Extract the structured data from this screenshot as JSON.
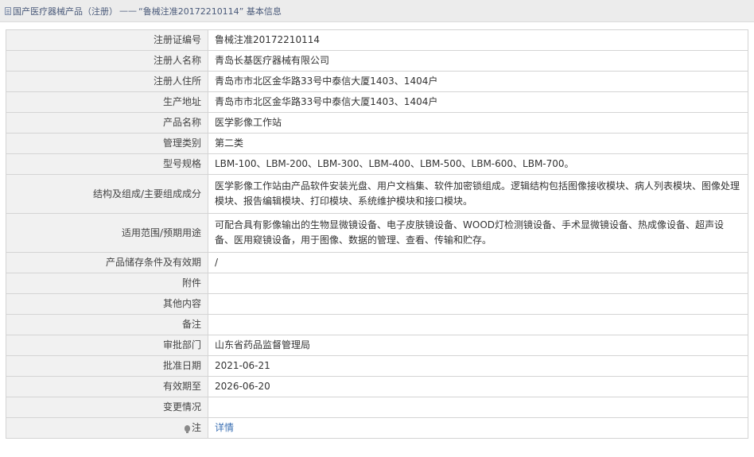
{
  "breadcrumb": {
    "root": "国产医疗器械产品（注册）",
    "separator": "——",
    "current": "“鲁械注准20172210114” 基本信息"
  },
  "rows": [
    {
      "label": "注册证编号",
      "value": "鲁械注准20172210114"
    },
    {
      "label": "注册人名称",
      "value": "青岛长基医疗器械有限公司"
    },
    {
      "label": "注册人住所",
      "value": "青岛市市北区金华路33号中泰信大厦1403、1404户"
    },
    {
      "label": "生产地址",
      "value": "青岛市市北区金华路33号中泰信大厦1403、1404户"
    },
    {
      "label": "产品名称",
      "value": "医学影像工作站"
    },
    {
      "label": "管理类别",
      "value": "第二类"
    },
    {
      "label": "型号规格",
      "value": "LBM-100、LBM-200、LBM-300、LBM-400、LBM-500、LBM-600、LBM-700。"
    },
    {
      "label": "结构及组成/主要组成成分",
      "value": "医学影像工作站由产品软件安装光盘、用户文档集、软件加密锁组成。逻辑结构包括图像接收模块、病人列表模块、图像处理模块、报告编辑模块、打印模块、系统维护模块和接口模块。"
    },
    {
      "label": "适用范围/预期用途",
      "value": "可配合具有影像输出的生物显微镜设备、电子皮肤镜设备、WOOD灯检测镜设备、手术显微镜设备、热成像设备、超声设备、医用窥镜设备，用于图像、数据的管理、查看、传输和贮存。"
    },
    {
      "label": "产品储存条件及有效期",
      "value": "/"
    },
    {
      "label": "附件",
      "value": ""
    },
    {
      "label": "其他内容",
      "value": ""
    },
    {
      "label": "备注",
      "value": ""
    },
    {
      "label": "审批部门",
      "value": "山东省药品监督管理局"
    },
    {
      "label": "批准日期",
      "value": "2021-06-21"
    },
    {
      "label": "有效期至",
      "value": "2026-06-20"
    },
    {
      "label": "变更情况",
      "value": ""
    },
    {
      "label": "注",
      "value": "详情"
    }
  ]
}
